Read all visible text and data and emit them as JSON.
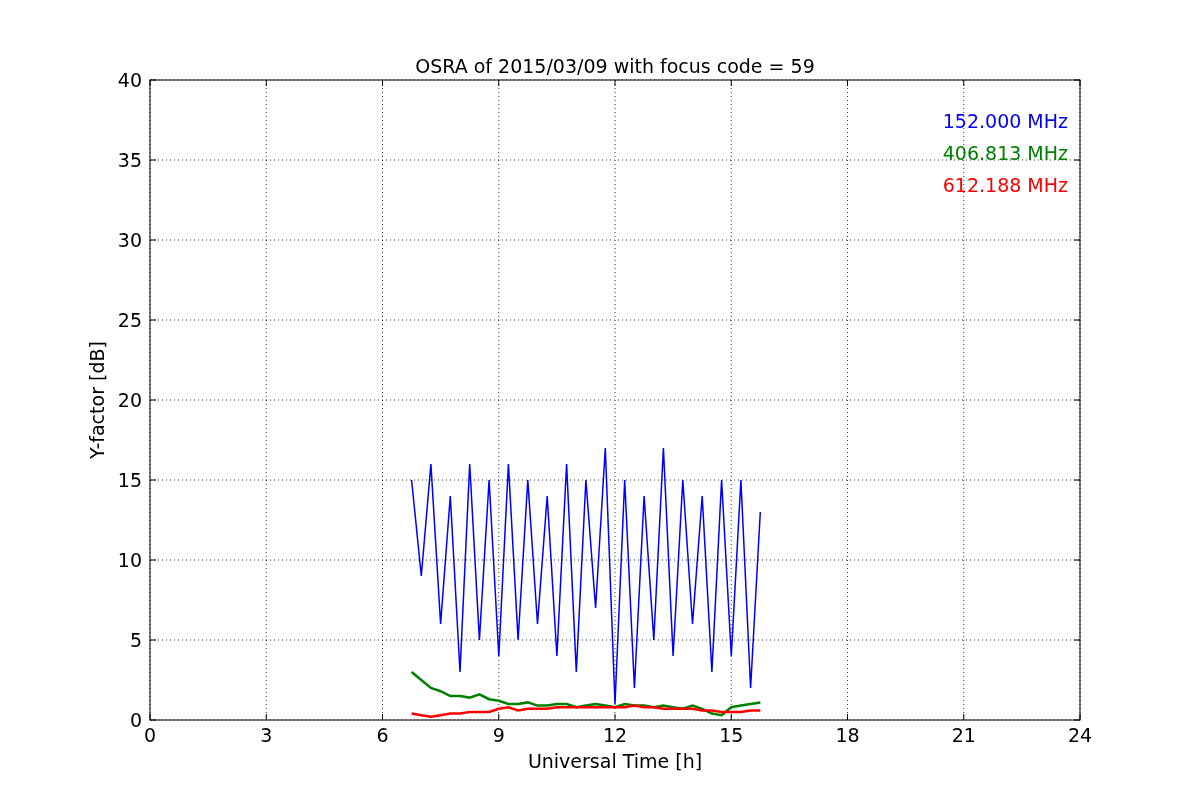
{
  "chart_data": {
    "type": "line",
    "title": "OSRA of 2015/03/09 with focus code = 59",
    "xlabel": "Universal Time [h]",
    "ylabel": "Y-factor [dB]",
    "x": [
      6.75,
      7,
      7.25,
      7.5,
      7.75,
      8,
      8.25,
      8.5,
      8.75,
      9,
      9.25,
      9.5,
      9.75,
      10,
      10.25,
      10.5,
      10.75,
      11,
      11.25,
      11.5,
      11.75,
      12,
      12.25,
      12.5,
      12.75,
      13,
      13.25,
      13.5,
      13.75,
      14,
      14.25,
      14.5,
      14.75,
      15,
      15.25,
      15.5,
      15.75
    ],
    "series": [
      {
        "name": "152.000 MHz",
        "color": "#0000ff",
        "values": [
          15,
          9,
          16,
          6,
          14,
          3,
          16,
          5,
          15,
          4,
          16,
          5,
          15,
          6,
          14,
          4,
          16,
          3,
          15,
          7,
          17,
          1,
          15,
          2,
          14,
          5,
          17,
          4,
          15,
          6,
          14,
          3,
          15,
          4,
          15,
          2,
          13
        ]
      },
      {
        "name": "406.813 MHz",
        "color": "#008000",
        "values": [
          3,
          2.5,
          2,
          1.8,
          1.5,
          1.5,
          1.4,
          1.6,
          1.3,
          1.2,
          1.0,
          1.0,
          1.1,
          0.9,
          0.9,
          1.0,
          1.0,
          0.8,
          0.9,
          1.0,
          0.9,
          0.8,
          1.0,
          0.9,
          0.9,
          0.8,
          0.9,
          0.8,
          0.7,
          0.9,
          0.7,
          0.4,
          0.3,
          0.8,
          0.9,
          1.0,
          1.1
        ]
      },
      {
        "name": "612.188 MHz",
        "color": "#ff0000",
        "values": [
          0.4,
          0.3,
          0.2,
          0.3,
          0.4,
          0.4,
          0.5,
          0.5,
          0.5,
          0.7,
          0.8,
          0.6,
          0.7,
          0.7,
          0.7,
          0.8,
          0.8,
          0.8,
          0.8,
          0.8,
          0.8,
          0.8,
          0.8,
          0.9,
          0.8,
          0.8,
          0.7,
          0.7,
          0.7,
          0.7,
          0.6,
          0.6,
          0.5,
          0.5,
          0.5,
          0.6,
          0.6
        ]
      }
    ],
    "xlim": [
      0,
      24
    ],
    "ylim": [
      0,
      40
    ],
    "xticks": [
      0,
      3,
      6,
      9,
      12,
      15,
      18,
      21,
      24
    ],
    "yticks": [
      0,
      5,
      10,
      15,
      20,
      25,
      30,
      35,
      40
    ],
    "grid": true
  }
}
